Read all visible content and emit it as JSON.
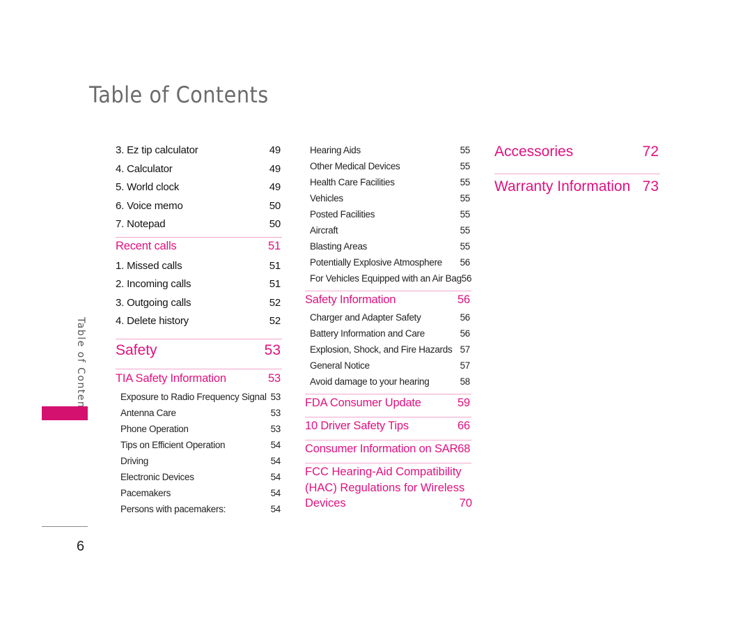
{
  "page_title": "Table of Contents",
  "side_label": "Table of Contents",
  "page_number": "6",
  "colors": {
    "accent": "#e0117f",
    "rule": "#f2a6cc",
    "tab": "#d4116f"
  },
  "column1": [
    {
      "type": "item",
      "label": "3. Ez tip calculator",
      "page": "49"
    },
    {
      "type": "item",
      "label": "4. Calculator",
      "page": "49"
    },
    {
      "type": "item",
      "label": "5. World clock",
      "page": "49"
    },
    {
      "type": "item",
      "label": "6. Voice memo",
      "page": "50"
    },
    {
      "type": "item",
      "label": "7. Notepad",
      "page": "50"
    },
    {
      "type": "head",
      "label": "Recent calls",
      "page": "51"
    },
    {
      "type": "item",
      "label": "1. Missed calls",
      "page": "51"
    },
    {
      "type": "item",
      "label": "2. Incoming calls",
      "page": "51"
    },
    {
      "type": "item",
      "label": "3. Outgoing calls",
      "page": "52"
    },
    {
      "type": "item",
      "label": "4. Delete history",
      "page": "52"
    },
    {
      "type": "big",
      "label": "Safety",
      "page": "53"
    },
    {
      "type": "head",
      "label": "TIA Safety Information",
      "page": "53"
    },
    {
      "type": "sub",
      "label": "Exposure to Radio Frequency Signal",
      "page": "53"
    },
    {
      "type": "sub",
      "label": "Antenna Care",
      "page": "53"
    },
    {
      "type": "sub",
      "label": "Phone Operation",
      "page": "53"
    },
    {
      "type": "sub",
      "label": "Tips on Efficient Operation",
      "page": "54"
    },
    {
      "type": "sub",
      "label": "Driving",
      "page": "54"
    },
    {
      "type": "sub",
      "label": "Electronic Devices",
      "page": "54"
    },
    {
      "type": "sub",
      "label": "Pacemakers",
      "page": "54"
    },
    {
      "type": "sub",
      "label": "Persons with pacemakers:",
      "page": "54"
    }
  ],
  "column2": [
    {
      "type": "sub",
      "label": "Hearing Aids",
      "page": "55"
    },
    {
      "type": "sub",
      "label": "Other Medical Devices",
      "page": "55"
    },
    {
      "type": "sub",
      "label": "Health Care Facilities",
      "page": "55"
    },
    {
      "type": "sub",
      "label": "Vehicles",
      "page": "55"
    },
    {
      "type": "sub",
      "label": "Posted Facilities",
      "page": "55"
    },
    {
      "type": "sub",
      "label": "Aircraft",
      "page": "55"
    },
    {
      "type": "sub",
      "label": "Blasting Areas",
      "page": "55"
    },
    {
      "type": "sub",
      "label": "Potentially Explosive Atmosphere",
      "page": "56"
    },
    {
      "type": "sub",
      "label": "For Vehicles Equipped with an Air Bag",
      "page": "56"
    },
    {
      "type": "head",
      "label": "Safety Information",
      "page": "56"
    },
    {
      "type": "sub",
      "label": "Charger and Adapter Safety",
      "page": "56"
    },
    {
      "type": "sub",
      "label": "Battery Information and Care",
      "page": "56"
    },
    {
      "type": "sub",
      "label": "Explosion, Shock, and Fire Hazards",
      "page": "57"
    },
    {
      "type": "sub",
      "label": "General Notice",
      "page": "57"
    },
    {
      "type": "sub",
      "label": "Avoid damage to your hearing",
      "page": "58"
    },
    {
      "type": "head",
      "label": "FDA Consumer Update",
      "page": "59"
    },
    {
      "type": "head",
      "label": "10 Driver Safety Tips",
      "page": "66"
    },
    {
      "type": "head",
      "label": "Consumer Information on SAR",
      "page": "68"
    }
  ],
  "fcc_entry": {
    "line1": "FCC Hearing-Aid Compatibility",
    "line2": "(HAC) Regulations for Wireless",
    "line3": "Devices",
    "page": "70"
  },
  "column3": [
    {
      "type": "big",
      "label": "Accessories",
      "page": "72"
    },
    {
      "type": "big",
      "label": "Warranty Information",
      "page": "73"
    }
  ]
}
